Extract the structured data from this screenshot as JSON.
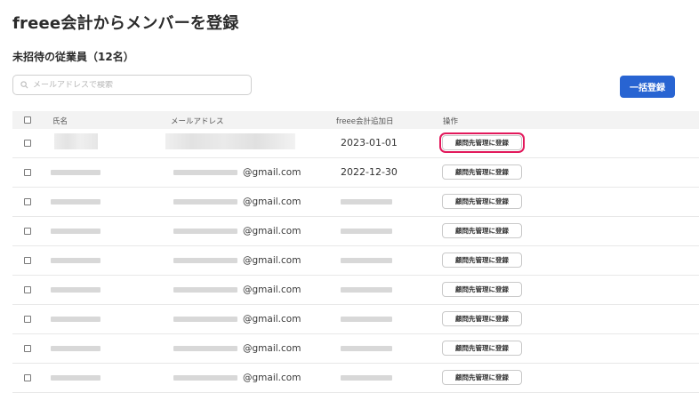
{
  "page": {
    "title": "freee会計からメンバーを登録",
    "section_title": "未招待の従業員（12名）"
  },
  "search": {
    "placeholder": "メールアドレスで検索",
    "value": ""
  },
  "toolbar": {
    "bulk_register_label": "一括登録",
    "accent_color": "#2864d2"
  },
  "table": {
    "headers": {
      "name": "氏名",
      "email": "メールアドレス",
      "date": "freee会計追加日",
      "action": "操作"
    },
    "action_label": "顧問先管理に登録",
    "highlight_color": "#e2185b",
    "rows": [
      {
        "email_suffix": "",
        "date": "2023-01-01",
        "highlighted": true
      },
      {
        "email_suffix": "@gmail.com",
        "date": "2022-12-30",
        "highlighted": false
      },
      {
        "email_suffix": "@gmail.com",
        "date": "",
        "highlighted": false
      },
      {
        "email_suffix": "@gmail.com",
        "date": "",
        "highlighted": false
      },
      {
        "email_suffix": "@gmail.com",
        "date": "",
        "highlighted": false
      },
      {
        "email_suffix": "@gmail.com",
        "date": "",
        "highlighted": false
      },
      {
        "email_suffix": "@gmail.com",
        "date": "",
        "highlighted": false
      },
      {
        "email_suffix": "@gmail.com",
        "date": "",
        "highlighted": false
      },
      {
        "email_suffix": "@gmail.com",
        "date": "",
        "highlighted": false
      }
    ]
  }
}
